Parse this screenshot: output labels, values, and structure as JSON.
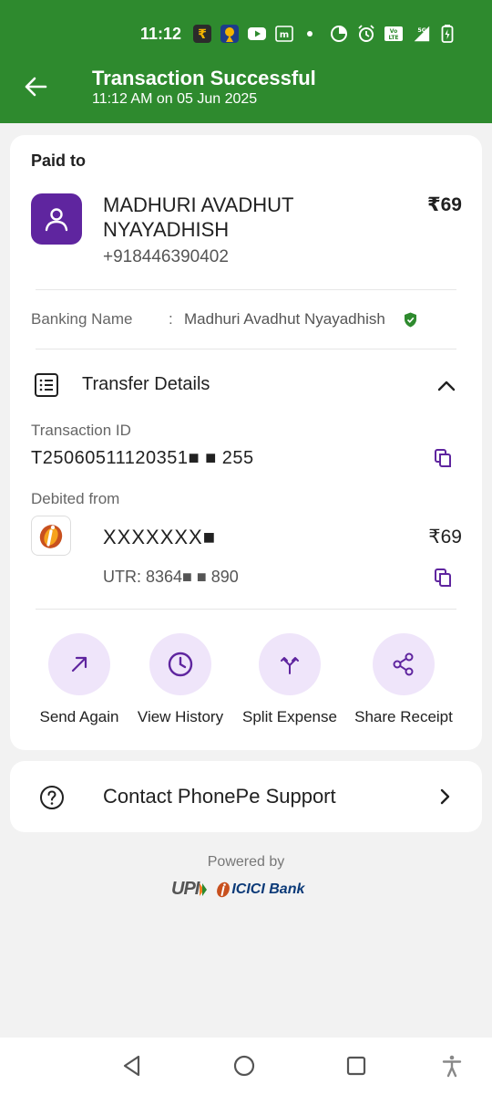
{
  "status_bar": {
    "time": "11:12",
    "icons": [
      "rupee-app-icon",
      "badge-app-icon",
      "youtube-icon",
      "m-app-icon",
      "dot-icon",
      "data-saver-icon",
      "alarm-icon",
      "volte-icon",
      "5g-signal-icon",
      "battery-icon"
    ],
    "volte_text": "VoLTE",
    "network_text": "5G"
  },
  "header": {
    "back_icon": "back-arrow-icon",
    "title": "Transaction Successful",
    "subtitle": "11:12 AM on 05 Jun 2025",
    "background": "#2e8a2e"
  },
  "paid_to": {
    "heading": "Paid to",
    "avatar_icon": "user-icon",
    "name": "MADHURI AVADHUT NYAYADHISH",
    "phone": "+918446390402",
    "amount": "₹69"
  },
  "banking_name": {
    "label": "Banking Name",
    "separator": ":",
    "value": "Madhuri Avadhut Nyayadhish",
    "verified_icon": "verified-shield-icon"
  },
  "transfer_details": {
    "icon": "list-document-icon",
    "label": "Transfer Details",
    "chevron_icon": "chevron-up-icon",
    "transaction_id_label": "Transaction ID",
    "transaction_id": "T25060511120351■ ■ 255",
    "debited_from_label": "Debited from",
    "account": "XXXXXXX■",
    "debit_amount": "₹69",
    "utr": "UTR: 8364■ ■ 890"
  },
  "actions": [
    {
      "label": "Send Again",
      "icon": "arrow-up-right-icon"
    },
    {
      "label": "View History",
      "icon": "clock-icon"
    },
    {
      "label": "Split Expense",
      "icon": "split-icon"
    },
    {
      "label": "Share Receipt",
      "icon": "share-icon"
    }
  ],
  "support": {
    "icon": "help-circle-icon",
    "label": "Contact PhonePe Support",
    "chevron_icon": "chevron-right-icon"
  },
  "footer": {
    "powered_by": "Powered by",
    "upi_logo_text": "UPI",
    "bank_logo_text": "ICICI Bank"
  },
  "accent_color": "#5f259f",
  "accent_light": "#efe5fa"
}
